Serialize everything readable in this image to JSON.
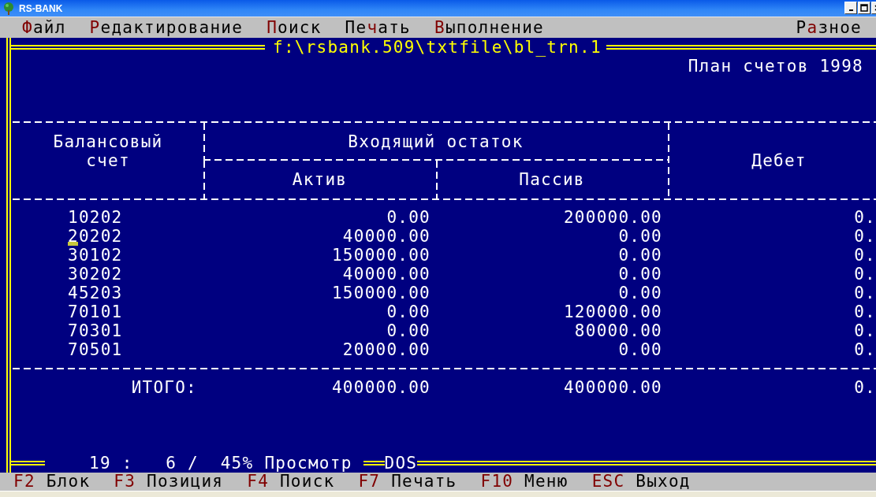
{
  "window": {
    "title": "RS-BANK"
  },
  "menu": [
    {
      "key": "Ф",
      "after": "айл"
    },
    {
      "key": "Р",
      "after": "едактирование"
    },
    {
      "key": "П",
      "after": "оиск"
    },
    {
      "before": "Пе",
      "key": "ч",
      "after": "ать"
    },
    {
      "key": "В",
      "after": "ыполнение"
    },
    {
      "before": "Р",
      "key": "а",
      "after": "зное"
    }
  ],
  "document": {
    "path": "f:\\rsbank.509\\txtfile\\bl_trn.1",
    "heading": "План счетов 1998",
    "table": {
      "columns": {
        "account": "Балансовый счет",
        "opening_balance": "Входящий остаток",
        "assets": "Актив",
        "liabilities": "Пассив",
        "debit": "Дебет"
      },
      "rows": [
        {
          "account": "10202",
          "assets": "0.00",
          "liabilities": "200000.00",
          "debit": "0.",
          "cursor": false
        },
        {
          "account": "20202",
          "assets": "40000.00",
          "liabilities": "0.00",
          "debit": "0.",
          "cursor": true
        },
        {
          "account": "30102",
          "assets": "150000.00",
          "liabilities": "0.00",
          "debit": "0.",
          "cursor": false
        },
        {
          "account": "30202",
          "assets": "40000.00",
          "liabilities": "0.00",
          "debit": "0.",
          "cursor": false
        },
        {
          "account": "45203",
          "assets": "150000.00",
          "liabilities": "0.00",
          "debit": "0.",
          "cursor": false
        },
        {
          "account": "70101",
          "assets": "0.00",
          "liabilities": "120000.00",
          "debit": "0.",
          "cursor": false
        },
        {
          "account": "70301",
          "assets": "0.00",
          "liabilities": "80000.00",
          "debit": "0.",
          "cursor": false
        },
        {
          "account": "70501",
          "assets": "20000.00",
          "liabilities": "0.00",
          "debit": "0.",
          "cursor": false
        }
      ],
      "total": {
        "label": "ИТОГО:",
        "assets": "400000.00",
        "liabilities": "400000.00",
        "debit": "0."
      }
    }
  },
  "status": {
    "position": "19 :   6 /  45%",
    "mode": "Просмотр",
    "encoding": "DOS"
  },
  "function_keys": [
    {
      "key": "F2",
      "label": "Блок"
    },
    {
      "key": "F3",
      "label": "Позиция"
    },
    {
      "key": "F4",
      "label": "Поиск"
    },
    {
      "key": "F7",
      "label": "Печать"
    },
    {
      "key": "F10",
      "label": "Меню"
    },
    {
      "key": "ESC",
      "label": "Выход"
    }
  ]
}
